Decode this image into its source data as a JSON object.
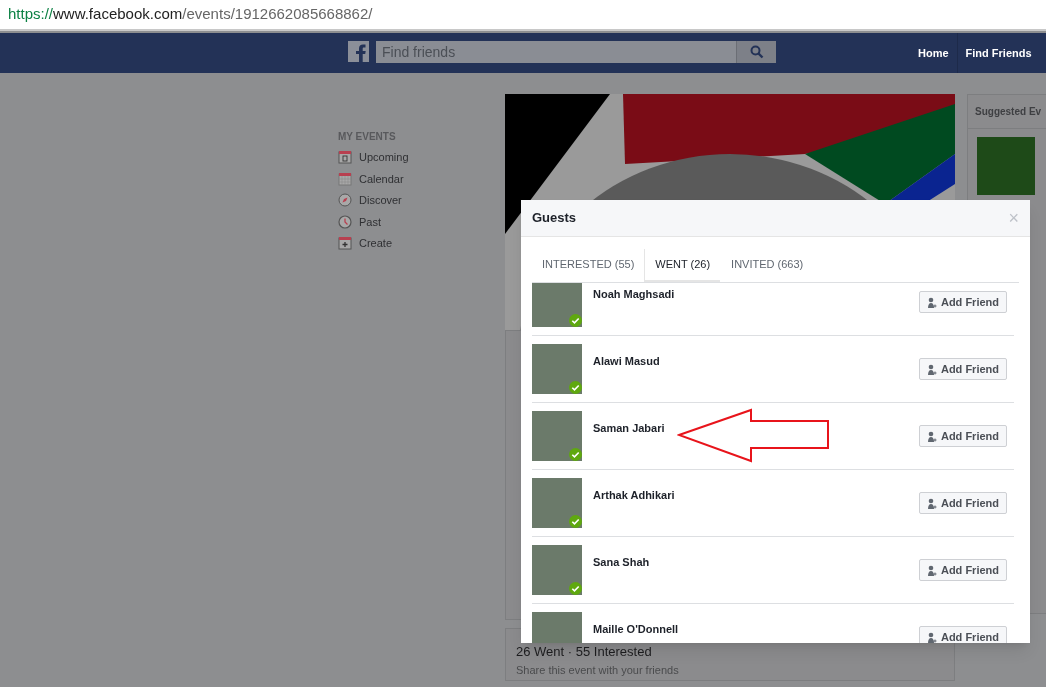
{
  "browser": {
    "url_scheme": "https://",
    "url_host": "www.facebook.com",
    "url_path": "/events/1912662085668862/"
  },
  "header": {
    "search": {
      "placeholder": "Find friends"
    },
    "nav": [
      "Home",
      "Find Friends"
    ]
  },
  "sidebar": {
    "heading": "MY EVENTS",
    "items": [
      {
        "label": "Upcoming",
        "kind": "upcoming"
      },
      {
        "label": "Calendar",
        "kind": "calendar"
      },
      {
        "label": "Discover",
        "kind": "discover"
      },
      {
        "label": "Past",
        "kind": "past"
      },
      {
        "label": "Create",
        "kind": "create"
      }
    ]
  },
  "suggested": {
    "title": "Suggested Ev"
  },
  "event_summary": {
    "counts": "26 Went · 55 Interested",
    "hint": "Share this event with your friends"
  },
  "dialog": {
    "title": "Guests",
    "close": "×",
    "tabs": [
      {
        "label": "INTERESTED (55)",
        "selected": false
      },
      {
        "label": "WENT (26)",
        "selected": true
      },
      {
        "label": "INVITED (663)",
        "selected": false
      }
    ],
    "guests": [
      {
        "name": "Noah Maghsadi",
        "went": true,
        "button": "Add Friend"
      },
      {
        "name": "Alawi Masud",
        "went": true,
        "button": "Add Friend"
      },
      {
        "name": "Saman Jabari",
        "went": true,
        "button": "Add Friend"
      },
      {
        "name": "Arthak Adhikari",
        "went": true,
        "button": "Add Friend"
      },
      {
        "name": "Sana Shah",
        "went": true,
        "button": "Add Friend"
      },
      {
        "name": "Maille O'Donnell",
        "button": "Add Friend"
      }
    ]
  }
}
